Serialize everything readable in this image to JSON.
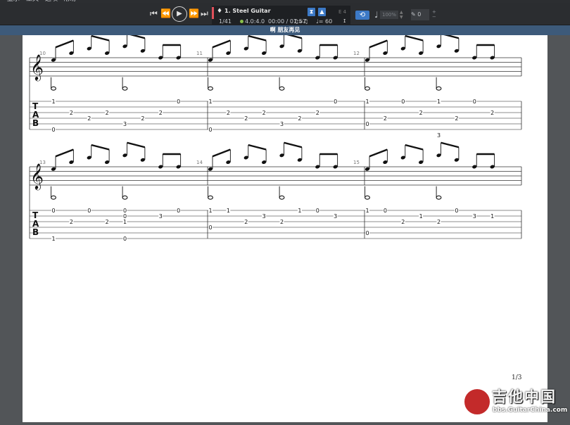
{
  "menu": [
    "显示",
    "工具",
    "选项",
    "帮助"
  ],
  "toolbar": {
    "transport": {
      "first": "⏮",
      "rewind": "⏪",
      "play": "▶",
      "forward": "⏩",
      "last": "⏭"
    },
    "track_name": "1. Steel Guitar",
    "bar_counter": "1/41",
    "time_signature": "4.0:4.0",
    "time_display": "00:00 / 01:57",
    "triplet_feel": "♫=♫",
    "tempo": "♩= 60",
    "key_sig": "E 4",
    "speed_value": "100%",
    "pitch_value": "0"
  },
  "colors": {
    "accent": "#3c79c6",
    "track": "#e0505a",
    "title_bar": "#3d5a7a"
  },
  "doc_title": "啊 朋友再见",
  "page_number": "1/3",
  "watermark": {
    "text": "吉他中国",
    "url": "bbs.GuitarChina.com"
  },
  "score": {
    "systems": [
      {
        "measures": [
          {
            "number": "10",
            "tab": [
              {
                "s": 1,
                "f": "1",
                "b": 0
              },
              {
                "s": 6,
                "f": "0",
                "b": 0
              },
              {
                "s": 3,
                "f": "2",
                "b": 1
              },
              {
                "s": 4,
                "f": "2",
                "b": 2
              },
              {
                "s": 3,
                "f": "2",
                "b": 3
              },
              {
                "s": 5,
                "f": "3",
                "b": 4
              },
              {
                "s": 4,
                "f": "2",
                "b": 5
              },
              {
                "s": 3,
                "f": "2",
                "b": 6
              },
              {
                "s": 1,
                "f": "0",
                "b": 7
              }
            ]
          },
          {
            "number": "11",
            "tab": [
              {
                "s": 1,
                "f": "1",
                "b": 0
              },
              {
                "s": 6,
                "f": "0",
                "b": 0
              },
              {
                "s": 3,
                "f": "2",
                "b": 1
              },
              {
                "s": 4,
                "f": "2",
                "b": 2
              },
              {
                "s": 3,
                "f": "2",
                "b": 3
              },
              {
                "s": 5,
                "f": "3",
                "b": 4
              },
              {
                "s": 4,
                "f": "2",
                "b": 5
              },
              {
                "s": 3,
                "f": "2",
                "b": 6
              },
              {
                "s": 1,
                "f": "0",
                "b": 7
              }
            ]
          },
          {
            "number": "12",
            "tab": [
              {
                "s": 1,
                "f": "1",
                "b": 0
              },
              {
                "s": 5,
                "f": "0",
                "b": 0
              },
              {
                "s": 4,
                "f": "2",
                "b": 1
              },
              {
                "s": 1,
                "f": "0",
                "b": 2
              },
              {
                "s": 3,
                "f": "2",
                "b": 3
              },
              {
                "s": 1,
                "f": "1",
                "b": 4
              },
              {
                "s": 7,
                "f": "3",
                "b": 4
              },
              {
                "s": 4,
                "f": "2",
                "b": 5
              },
              {
                "s": 1,
                "f": "0",
                "b": 6
              },
              {
                "s": 3,
                "f": "2",
                "b": 7
              }
            ]
          }
        ]
      },
      {
        "measures": [
          {
            "number": "13",
            "tab": [
              {
                "s": 1,
                "f": "0",
                "b": 0
              },
              {
                "s": 6,
                "f": "1",
                "b": 0
              },
              {
                "s": 3,
                "f": "2",
                "b": 1
              },
              {
                "s": 1,
                "f": "0",
                "b": 2
              },
              {
                "s": 3,
                "f": "2",
                "b": 3
              },
              {
                "s": 1,
                "f": "0",
                "b": 4
              },
              {
                "s": 2,
                "f": "0",
                "b": 4
              },
              {
                "s": 3,
                "f": "1",
                "b": 4
              },
              {
                "s": 6,
                "f": "0",
                "b": 4
              },
              {
                "s": 2,
                "f": "3",
                "b": 6
              },
              {
                "s": 1,
                "f": "0",
                "b": 7
              }
            ]
          },
          {
            "number": "14",
            "tab": [
              {
                "s": 1,
                "f": "1",
                "b": 0
              },
              {
                "s": 4,
                "f": "0",
                "b": 0
              },
              {
                "s": 1,
                "f": "1",
                "b": 1
              },
              {
                "s": 3,
                "f": "2",
                "b": 2
              },
              {
                "s": 2,
                "f": "3",
                "b": 3
              },
              {
                "s": 3,
                "f": "2",
                "b": 4
              },
              {
                "s": 1,
                "f": "1",
                "b": 5
              },
              {
                "s": 1,
                "f": "0",
                "b": 6
              },
              {
                "s": 2,
                "f": "3",
                "b": 7
              }
            ]
          },
          {
            "number": "15",
            "tab": [
              {
                "s": 1,
                "f": "1",
                "b": 0
              },
              {
                "s": 5,
                "f": "0",
                "b": 0
              },
              {
                "s": 1,
                "f": "0",
                "b": 1
              },
              {
                "s": 3,
                "f": "2",
                "b": 2
              },
              {
                "s": 2,
                "f": "1",
                "b": 3
              },
              {
                "s": 3,
                "f": "2",
                "b": 4
              },
              {
                "s": 1,
                "f": "0",
                "b": 5
              },
              {
                "s": 2,
                "f": "3",
                "b": 6
              },
              {
                "s": 2,
                "f": "1",
                "b": 7
              }
            ]
          }
        ]
      }
    ],
    "notation": {
      "melody_steps": [
        0,
        -3,
        -5,
        -3,
        -6,
        -4,
        -1,
        -1
      ],
      "bass_step": -11
    }
  }
}
